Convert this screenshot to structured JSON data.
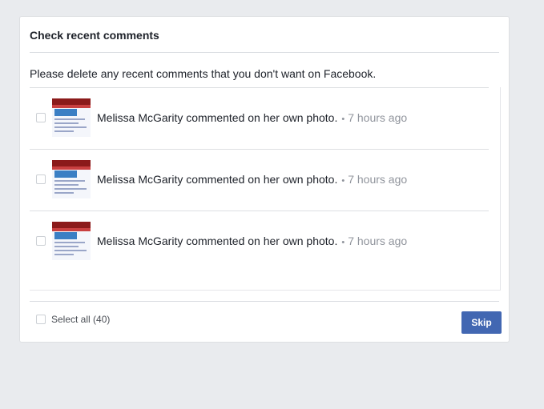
{
  "dialog": {
    "title": "Check recent comments",
    "instructions": "Please delete any recent comments that you don't want on Facebook."
  },
  "comments": [
    {
      "text": "Melissa McGarity commented on her own photo.",
      "separator": "•",
      "time": "7 hours ago"
    },
    {
      "text": "Melissa McGarity commented on her own photo.",
      "separator": "•",
      "time": "7 hours ago"
    },
    {
      "text": "Melissa McGarity commented on her own photo.",
      "separator": "•",
      "time": "7 hours ago"
    }
  ],
  "footer": {
    "select_all_label": "Select all (40)",
    "skip_label": "Skip"
  },
  "colors": {
    "page_background": "#e9ebee",
    "primary_button": "#4267b2",
    "secondary_text": "#90949c"
  }
}
